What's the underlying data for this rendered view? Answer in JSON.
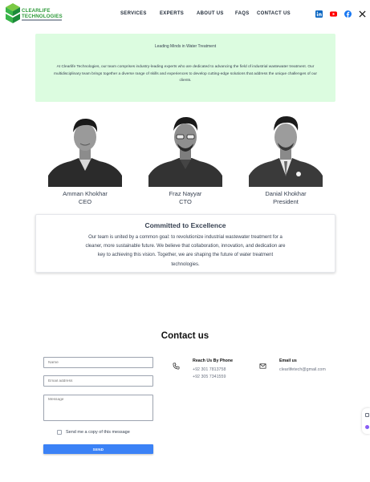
{
  "header": {
    "logo_line1": "CLEARLIFE",
    "logo_line2": "TECHNOLOGIES",
    "nav": [
      "SERVICES",
      "EXPERTS",
      "ABOUT US",
      "FAQS",
      "CONTACT US"
    ],
    "socials": [
      "linkedin-icon",
      "youtube-icon",
      "facebook-icon",
      "x-icon"
    ]
  },
  "intro": {
    "title": "Leading Minds in Water Treatment",
    "body": "At Clearlife Technologies, our team comprises industry-leading experts who are dedicated to advancing the field of industrial wastewater treatment. Our multidisciplinary team brings together a diverse range of skills and experiences to develop cutting-edge solutions that address the unique challenges of our clients."
  },
  "team": [
    {
      "name": "Amman Khokhar",
      "role": "CEO"
    },
    {
      "name": "Fraz Nayyar",
      "role": "CTO"
    },
    {
      "name": "Danial Khokhar",
      "role": "President"
    }
  ],
  "committed": {
    "title": "Committed to Excellence",
    "body": "Our team is united by a common goal: to revolutionize industrial wastewater treatment for a cleaner, more sustainable future. We believe that collaboration, innovation, and dedication are key to achieving this vision. Together, we are shaping the future of water treatment technologies."
  },
  "contact": {
    "title": "Contact us",
    "name_placeholder": "Name",
    "email_placeholder": "Email address",
    "message_placeholder": "Message",
    "copy_label": "Send me a copy of this message",
    "send_label": "SEND",
    "phone_title": "Reach Us By Phone",
    "phone1": "+92 301 7813758",
    "phone2": "+92 305 7341559",
    "email_title": "Email us",
    "email": "clearlifetech@gmail.com"
  },
  "colors": {
    "intro_bg": "#dcfce0",
    "brand_green": "#2e9a3a",
    "send_blue": "#3b82f6",
    "linkedin": "#0a66c2",
    "youtube": "#ff0000",
    "facebook": "#1877f2"
  }
}
